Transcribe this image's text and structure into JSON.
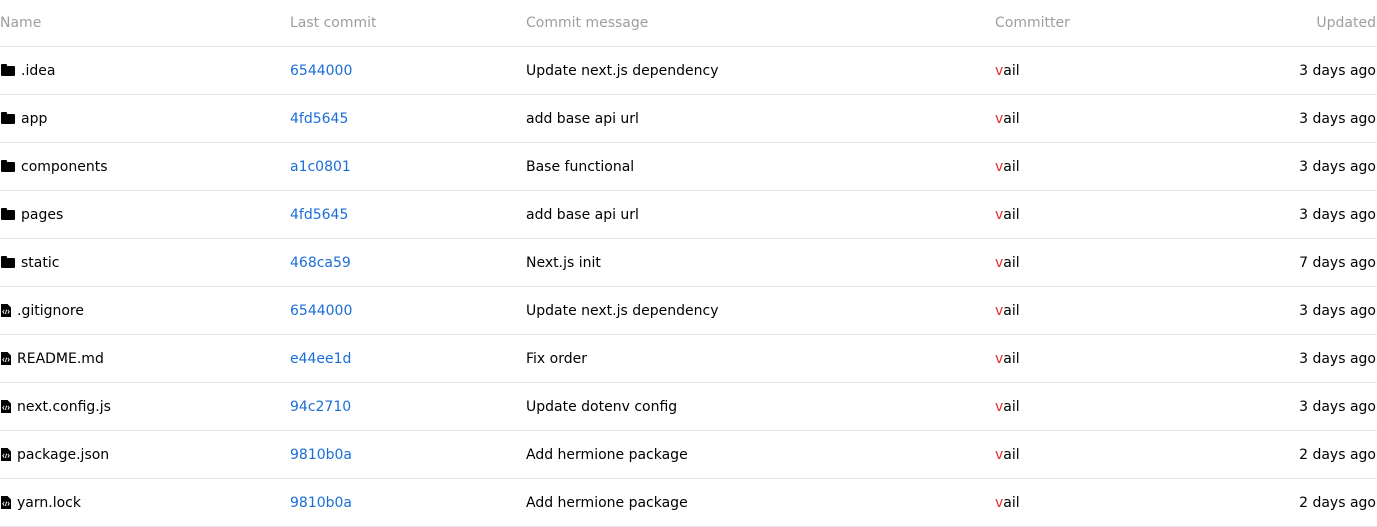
{
  "columns": {
    "name": "Name",
    "last_commit": "Last commit",
    "commit_message": "Commit message",
    "committer": "Committer",
    "updated": "Updated"
  },
  "rows": [
    {
      "type": "folder",
      "name": ".idea",
      "commit": "6544000",
      "message": "Update next.js dependency",
      "committer_first": "v",
      "committer_rest": "ail",
      "updated": "3 days ago"
    },
    {
      "type": "folder",
      "name": "app",
      "commit": "4fd5645",
      "message": "add base api url",
      "committer_first": "v",
      "committer_rest": "ail",
      "updated": "3 days ago"
    },
    {
      "type": "folder",
      "name": "components",
      "commit": "a1c0801",
      "message": "Base functional",
      "committer_first": "v",
      "committer_rest": "ail",
      "updated": "3 days ago"
    },
    {
      "type": "folder",
      "name": "pages",
      "commit": "4fd5645",
      "message": "add base api url",
      "committer_first": "v",
      "committer_rest": "ail",
      "updated": "3 days ago"
    },
    {
      "type": "folder",
      "name": "static",
      "commit": "468ca59",
      "message": "Next.js init",
      "committer_first": "v",
      "committer_rest": "ail",
      "updated": "7 days ago"
    },
    {
      "type": "file",
      "name": ".gitignore",
      "commit": "6544000",
      "message": "Update next.js dependency",
      "committer_first": "v",
      "committer_rest": "ail",
      "updated": "3 days ago"
    },
    {
      "type": "file",
      "name": "README.md",
      "commit": "e44ee1d",
      "message": "Fix order",
      "committer_first": "v",
      "committer_rest": "ail",
      "updated": "3 days ago"
    },
    {
      "type": "file",
      "name": "next.config.js",
      "commit": "94c2710",
      "message": "Update dotenv config",
      "committer_first": "v",
      "committer_rest": "ail",
      "updated": "3 days ago"
    },
    {
      "type": "file",
      "name": "package.json",
      "commit": "9810b0a",
      "message": "Add hermione package",
      "committer_first": "v",
      "committer_rest": "ail",
      "updated": "2 days ago"
    },
    {
      "type": "file",
      "name": "yarn.lock",
      "commit": "9810b0a",
      "message": "Add hermione package",
      "committer_first": "v",
      "committer_rest": "ail",
      "updated": "2 days ago"
    }
  ],
  "colors": {
    "header_text": "#9e9e9e",
    "link": "#1a6ed8",
    "committer_accent": "#e52d2d",
    "divider": "#e8e8e8"
  }
}
